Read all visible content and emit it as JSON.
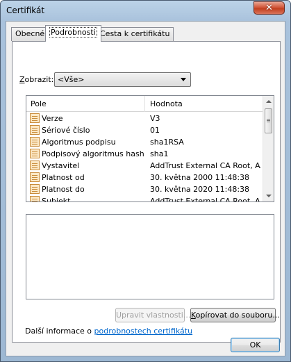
{
  "window": {
    "title": "Certifikát",
    "close_symbol": "✕"
  },
  "tabs": [
    {
      "label": "Obecné",
      "active": false
    },
    {
      "label": "Podrobnosti",
      "active": true
    },
    {
      "label": "Cesta k certifikátu",
      "active": false
    }
  ],
  "show": {
    "label_accel": "Z",
    "label_rest": "obrazit:",
    "selected": "<Vše>"
  },
  "list": {
    "headers": {
      "field": "Pole",
      "value": "Hodnota"
    },
    "rows": [
      {
        "field": "Verze",
        "value": "V3"
      },
      {
        "field": "Sériové číslo",
        "value": "01"
      },
      {
        "field": "Algoritmus podpisu",
        "value": "sha1RSA"
      },
      {
        "field": "Podpisový algoritmus hash",
        "value": "sha1"
      },
      {
        "field": "Vystavitel",
        "value": "AddTrust External CA Root, A..."
      },
      {
        "field": "Platnost od",
        "value": "30. května 2000 11:48:38"
      },
      {
        "field": "Platnost do",
        "value": "30. května 2020 11:48:38"
      },
      {
        "field": "Subjekt",
        "value": "AddTrust External CA Root, A..."
      }
    ]
  },
  "buttons": {
    "edit_properties": "Upravit vlastnosti...",
    "copy_to_file_accel": "K",
    "copy_to_file_rest": "opírovat do souboru...",
    "ok": "OK"
  },
  "info": {
    "prefix": "Další informace o ",
    "link": "podrobnostech certifikátu"
  },
  "colors": {
    "link": "#0066cc",
    "close": "#c2401f",
    "title_bar": "#a9c2dc"
  }
}
